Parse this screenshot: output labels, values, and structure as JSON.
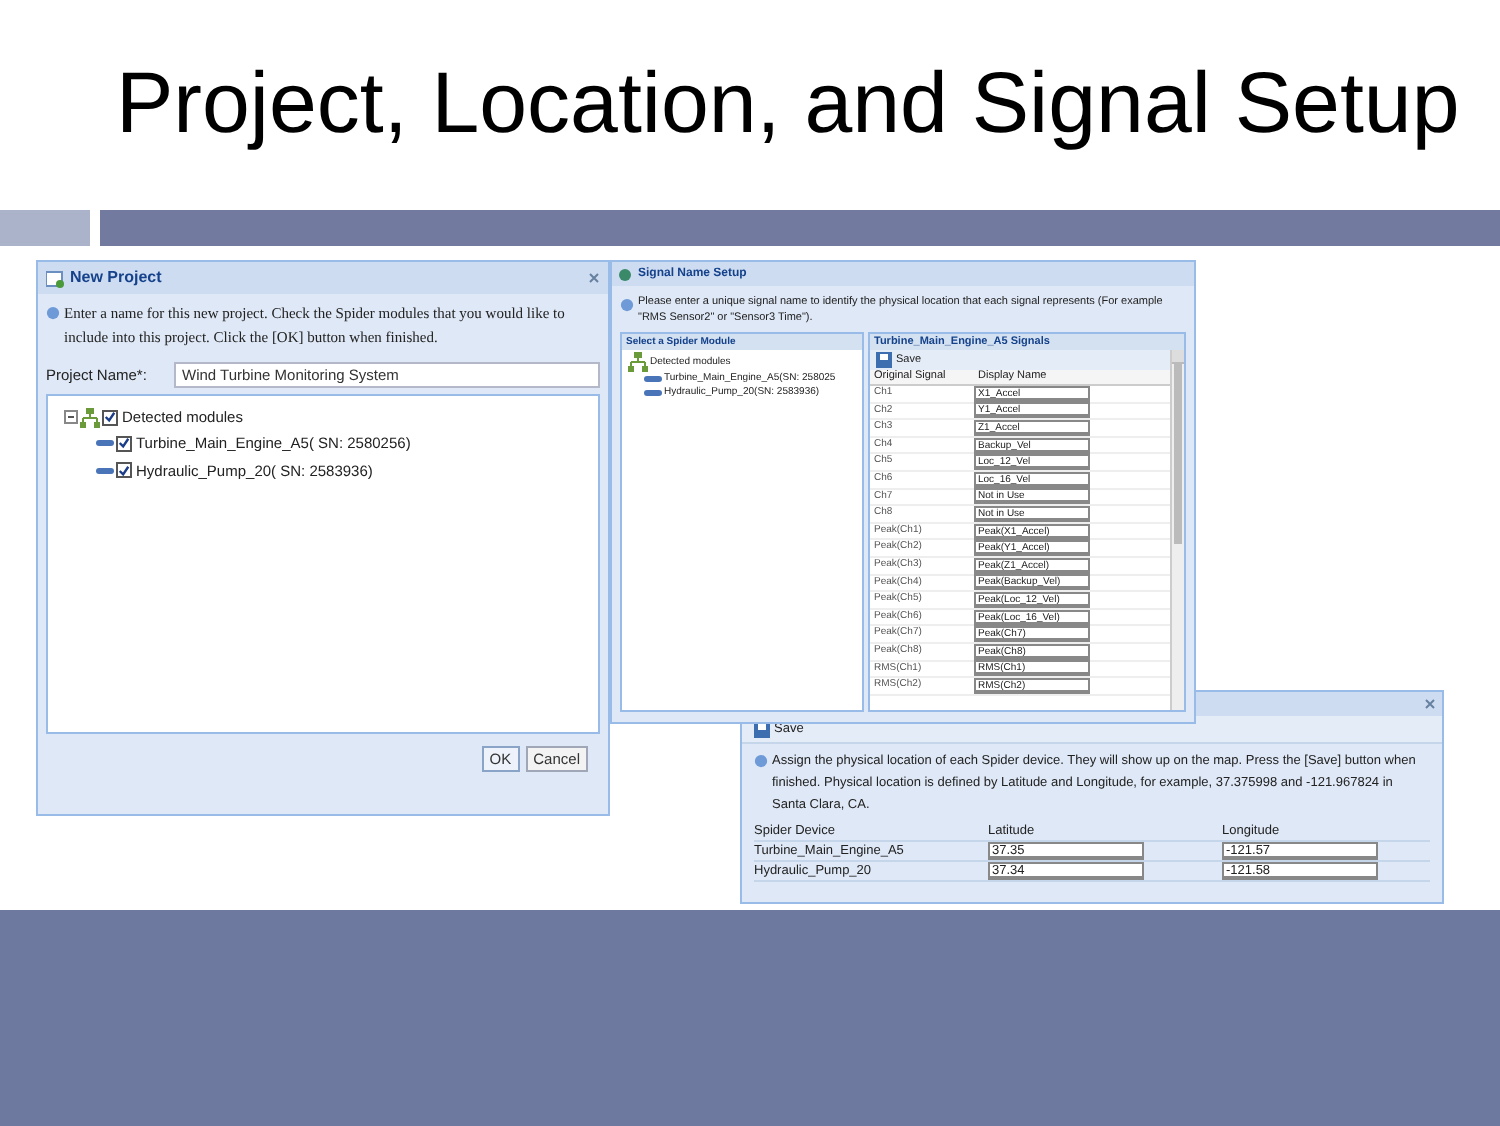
{
  "slide": {
    "title": "Project, Location, and Signal Setup"
  },
  "new_project": {
    "title": "New Project",
    "info": "Enter a name for this new project. Check the Spider modules that you would like to include into this project. Click the [OK] button when finished.",
    "project_name_label": "Project Name*:",
    "project_name_value": "Wind Turbine Monitoring System",
    "tree": {
      "label": "Detected modules",
      "checked": true,
      "children": [
        {
          "label": "Turbine_Main_Engine_A5( SN: 2580256)",
          "checked": true
        },
        {
          "label": "Hydraulic_Pump_20( SN: 2583936)",
          "checked": true
        }
      ]
    },
    "buttons": [
      {
        "label": "OK",
        "kind": "primary"
      },
      {
        "label": "Cancel",
        "kind": "secondary"
      }
    ]
  },
  "signal_setup": {
    "title": "Signal Name Setup",
    "info": "Please enter a unique signal name to identify the physical location that each signal represents (For example \"RMS Sensor2\" or \"Sensor3 Time\").",
    "module_panel_title": "Select a Spider Module",
    "tree": {
      "label": "Detected modules",
      "children": [
        {
          "label": "Turbine_Main_Engine_A5(SN: 258025"
        },
        {
          "label": "Hydraulic_Pump_20(SN: 2583936)"
        }
      ]
    },
    "signals_title": "Turbine_Main_Engine_A5 Signals",
    "save_label": "Save",
    "columns": [
      "Original Signal",
      "Display Name"
    ],
    "rows": [
      {
        "original": "Ch1",
        "display": "X1_Accel"
      },
      {
        "original": "Ch2",
        "display": "Y1_Accel"
      },
      {
        "original": "Ch3",
        "display": "Z1_Accel"
      },
      {
        "original": "Ch4",
        "display": "Backup_Vel"
      },
      {
        "original": "Ch5",
        "display": "Loc_12_Vel"
      },
      {
        "original": "Ch6",
        "display": "Loc_16_Vel"
      },
      {
        "original": "Ch7",
        "display": "Not in Use"
      },
      {
        "original": "Ch8",
        "display": "Not in Use"
      },
      {
        "original": "Peak(Ch1)",
        "display": "Peak(X1_Accel)"
      },
      {
        "original": "Peak(Ch2)",
        "display": "Peak(Y1_Accel)"
      },
      {
        "original": "Peak(Ch3)",
        "display": "Peak(Z1_Accel)"
      },
      {
        "original": "Peak(Ch4)",
        "display": "Peak(Backup_Vel)"
      },
      {
        "original": "Peak(Ch5)",
        "display": "Peak(Loc_12_Vel)"
      },
      {
        "original": "Peak(Ch6)",
        "display": "Peak(Loc_16_Vel)"
      },
      {
        "original": "Peak(Ch7)",
        "display": "Peak(Ch7)"
      },
      {
        "original": "Peak(Ch8)",
        "display": "Peak(Ch8)"
      },
      {
        "original": "RMS(Ch1)",
        "display": "RMS(Ch1)"
      },
      {
        "original": "RMS(Ch2)",
        "display": "RMS(Ch2)"
      }
    ]
  },
  "location": {
    "save_label": "Save",
    "info": "Assign the physical location of each Spider device. They will show up on the map. Press the [Save] button when finished. Physical location is defined by Latitude and Longitude, for example, 37.375998 and -121.967824 in Santa Clara, CA.",
    "columns": [
      "Spider Device",
      "Latitude",
      "Longitude"
    ],
    "rows": [
      {
        "device": "Turbine_Main_Engine_A5",
        "latitude": "37.35",
        "longitude": "-121.57"
      },
      {
        "device": "Hydraulic_Pump_20",
        "latitude": "37.34",
        "longitude": "-121.58"
      }
    ]
  }
}
